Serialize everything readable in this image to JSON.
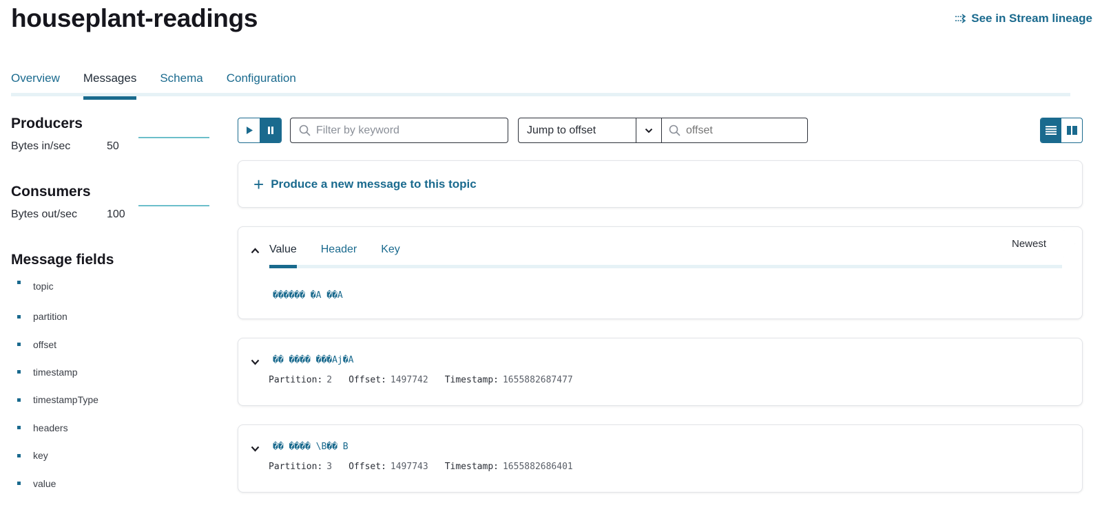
{
  "header": {
    "title": "houseplant-readings",
    "lineage_link": "See in Stream lineage",
    "lineage_icon": "stream-lineage-icon"
  },
  "tabs": [
    {
      "label": "Overview",
      "active": false
    },
    {
      "label": "Messages",
      "active": true
    },
    {
      "label": "Schema",
      "active": false
    },
    {
      "label": "Configuration",
      "active": false
    }
  ],
  "sidebar": {
    "producers": {
      "heading": "Producers",
      "metric_label": "Bytes in/sec",
      "metric_value": "50"
    },
    "consumers": {
      "heading": "Consumers",
      "metric_label": "Bytes out/sec",
      "metric_value": "100"
    },
    "message_fields": {
      "heading": "Message fields",
      "items": [
        "topic",
        "partition",
        "offset",
        "timestamp",
        "timestampType",
        "headers",
        "key",
        "value"
      ]
    }
  },
  "toolbar": {
    "play_icon": "play-icon",
    "pause_icon": "pause-icon",
    "filter_placeholder": "Filter by keyword",
    "filter_value": "",
    "jump_select_value": "Jump to offset",
    "offset_placeholder": "offset",
    "offset_value": "",
    "view_list_icon": "list-view-icon",
    "view_split_icon": "split-view-icon"
  },
  "produce": {
    "label": "Produce a new message to this topic"
  },
  "expanded_message": {
    "tabs": [
      {
        "label": "Value",
        "active": true
      },
      {
        "label": "Header",
        "active": false
      },
      {
        "label": "Key",
        "active": false
      }
    ],
    "value": "������ �A ��A",
    "badge": "Newest"
  },
  "messages": [
    {
      "value": "�� ���� ���Aj�A",
      "partition_label": "Partition:",
      "partition": "2",
      "offset_label": "Offset:",
      "offset": "1497742",
      "timestamp_label": "Timestamp:",
      "timestamp": "1655882687477"
    },
    {
      "value": "�� ���� \\B�� B",
      "partition_label": "Partition:",
      "partition": "3",
      "offset_label": "Offset:",
      "offset": "1497743",
      "timestamp_label": "Timestamp:",
      "timestamp": "1655882686401"
    }
  ],
  "colors": {
    "accent": "#1a6a8e",
    "sparkline": "#3aa8b8",
    "tab_track": "#e6f2f6"
  }
}
